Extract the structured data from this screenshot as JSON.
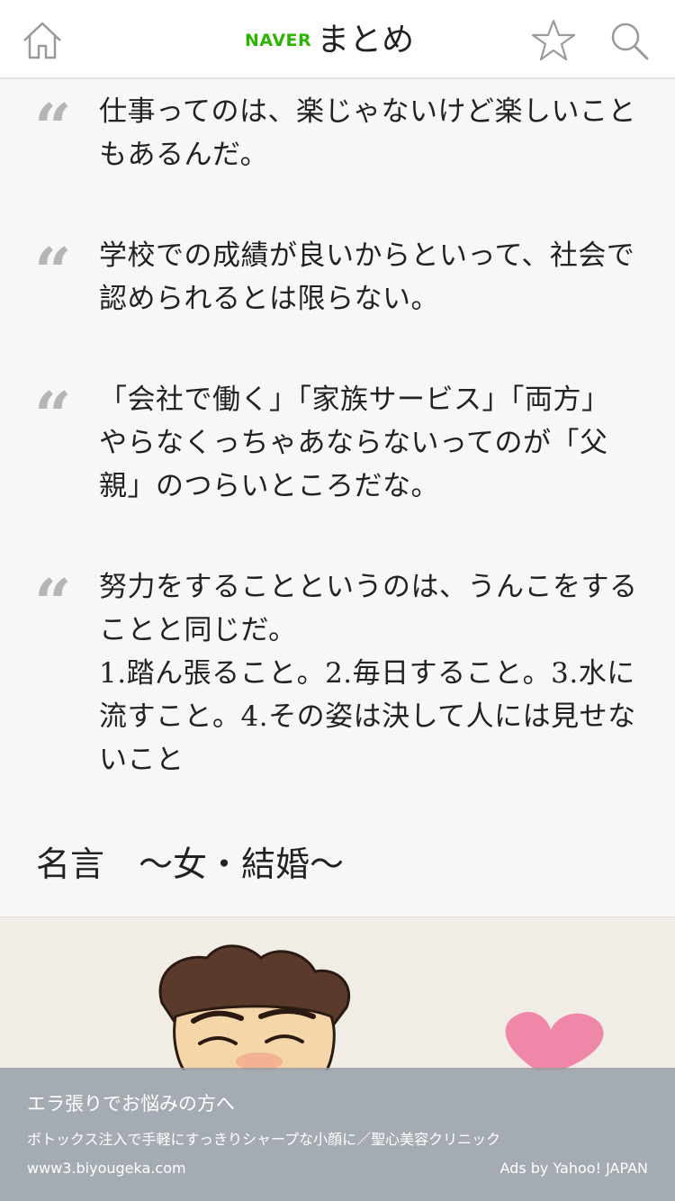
{
  "header": {
    "home_icon": "home-icon",
    "brand": "NAVER",
    "title": "まとめ",
    "star_icon": "star-icon",
    "search_icon": "search-icon",
    "brand_color": "#2db400"
  },
  "quotes": [
    {
      "mark": "“",
      "text": "仕事ってのは、楽じゃないけど楽しいこと\nもあるんだ。"
    },
    {
      "mark": "“",
      "text": "学校での成績が良いからといって、社会で\n認められるとは限らない。"
    },
    {
      "mark": "“",
      "text": "「会社で働く」「家族サービス」「両方」\nやらなくっちゃあならないってのが「父\n親」のつらいところだな。"
    },
    {
      "mark": "“",
      "text": "努力をすることというのは、うんこをする\nことと同じだ。\n1.踏ん張ること。2.毎日すること。3.水に\n流すこと。4.その姿は決して人には見せな\nいこと"
    }
  ],
  "section": {
    "title": "名言　～女・結婚～"
  },
  "ad": {
    "title": "エラ張りでお悩みの方へ",
    "description": "ボトックス注入で手軽にすっきりシャープな小顔に／聖心美容クリニック",
    "url": "www3.biyougeka.com",
    "attribution": "Ads by Yahoo! JAPAN"
  }
}
